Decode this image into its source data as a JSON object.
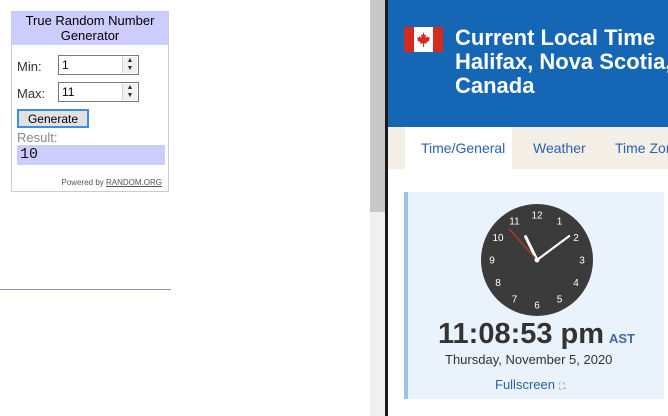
{
  "rng_widget": {
    "title": "True Random Number Generator",
    "min_label": "Min:",
    "min_value": "1",
    "max_label": "Max:",
    "max_value": "11",
    "generate_label": "Generate",
    "result_label": "Result:",
    "result_value": "10",
    "powered_by": "Powered by",
    "powered_link": "RANDOM.ORG"
  },
  "time_page": {
    "title": "Current Local Time\nHalifax, Nova Scotia,\nCanada",
    "tabs": [
      {
        "label": "Time/General",
        "active": true
      },
      {
        "label": "Weather",
        "active": false
      },
      {
        "label": "Time Zone",
        "active": false
      }
    ],
    "clock": {
      "hours": 11,
      "minutes": 8,
      "seconds": 53,
      "numerals": [
        "12",
        "1",
        "2",
        "3",
        "4",
        "5",
        "6",
        "7",
        "8",
        "9",
        "10",
        "11"
      ]
    },
    "time_text": "11:08:53 pm",
    "timezone": "AST",
    "date_text": "Thursday, November 5, 2020",
    "fullscreen_label": "Fullscreen",
    "icons": {
      "flag": "canada-flag-icon",
      "fullscreen": "fullscreen-icon"
    },
    "colors": {
      "header": "#1566b5",
      "tab_bar": "#f3efe7",
      "clock_face": "#3b3b3b",
      "second_hand": "#c0392b"
    }
  }
}
